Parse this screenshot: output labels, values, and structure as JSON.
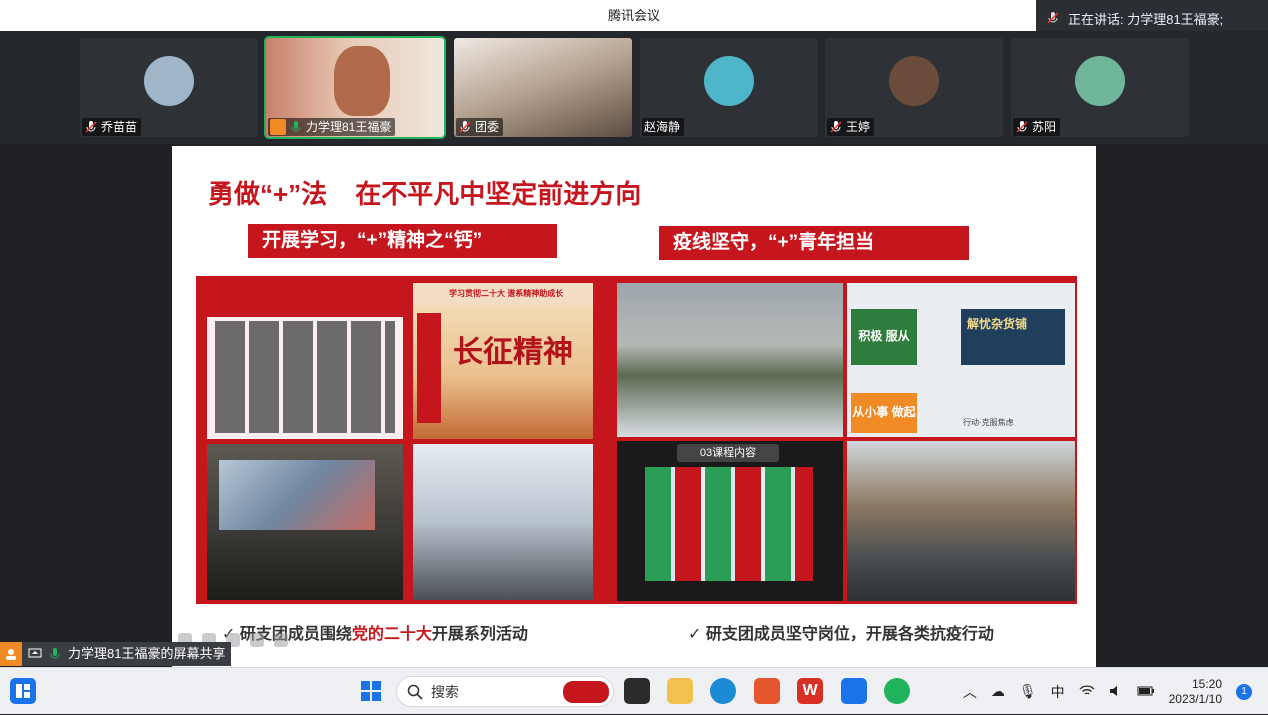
{
  "window": {
    "title": "腾讯会议"
  },
  "speaking": {
    "text": "正在讲话: 力学理81王福豪;"
  },
  "participants": [
    {
      "name": "乔苗苗",
      "mic": "muted",
      "kind": "avatar",
      "color": "#9fb6c8"
    },
    {
      "name": "力学理81王福豪",
      "mic": "active",
      "kind": "video",
      "color": "#b8553a",
      "active": true
    },
    {
      "name": "团委",
      "mic": "muted",
      "kind": "video",
      "color": "#8d7b6c"
    },
    {
      "name": "赵海静",
      "mic": "none",
      "kind": "avatar",
      "color": "#4fb6c9"
    },
    {
      "name": "王婷",
      "mic": "muted",
      "kind": "avatar",
      "color": "#6b4c3b"
    },
    {
      "name": "苏阳",
      "mic": "muted",
      "kind": "avatar",
      "color": "#6fb59a"
    }
  ],
  "slide": {
    "title_part1": "勇做“+”法",
    "title_part2": "在不平凡中坚定前进方向",
    "left_header": "开展学习，“+”精神之“钙”",
    "right_header": "疫线坚守，“+”青年担当",
    "left_caption_prefix": "✓ 研支团成员围绕",
    "left_caption_highlight": "党的二十大",
    "left_caption_suffix": "开展系列活动",
    "right_caption": "✓ 研支团成员坚守岗位，开展各类抗疫行动",
    "photo_texts": {
      "p2_header": "学习贯彻二十大 谱系精神助成长",
      "p2_art": "长征精神",
      "p7_label": "03课程内容",
      "p6_a": "积极 服从",
      "p6_b": "解忧杂货铺",
      "p6_c": "从小事 做起",
      "p6_d": "行动·克服焦虑"
    }
  },
  "share": {
    "label": "力学理81王福豪的屏幕共享"
  },
  "taskbar": {
    "search_placeholder": "搜索",
    "ime": "中",
    "time": "15:20",
    "date": "2023/1/10",
    "notification_count": "1"
  },
  "colors": {
    "accent_red": "#c4161c",
    "active_green": "#21b35c"
  }
}
